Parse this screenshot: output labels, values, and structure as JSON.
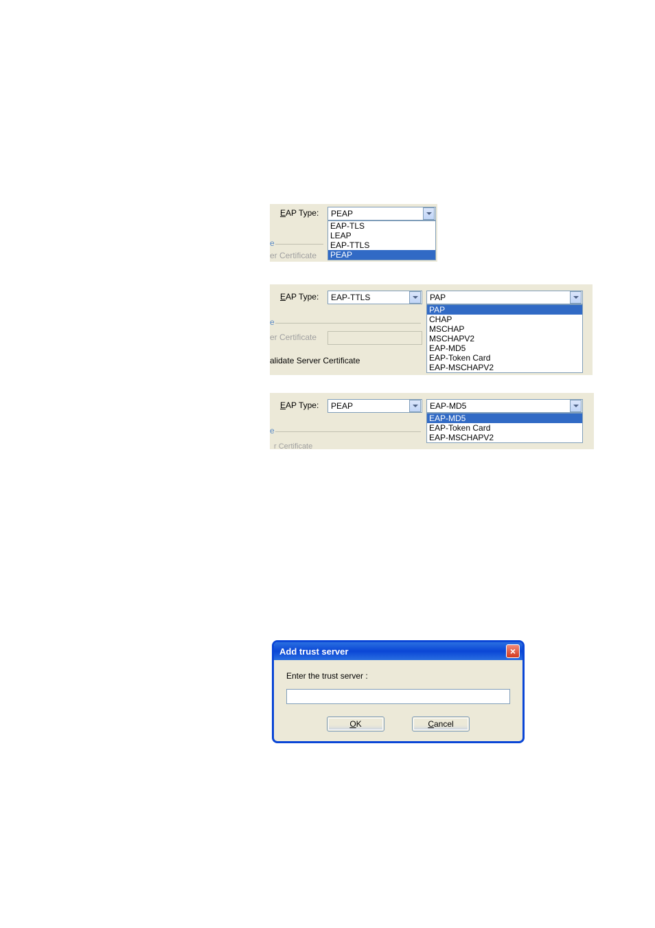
{
  "panel1": {
    "label_eap_type": "AP Type:",
    "label_eap_type_prefix": "E",
    "field_value": "PEAP",
    "list": [
      "EAP-TLS",
      "LEAP",
      "EAP-TTLS",
      "PEAP"
    ],
    "selected_index": 3,
    "frag_e": "e",
    "frag_cert": "er Certificate"
  },
  "panel2": {
    "label_eap_type": "AP Type:",
    "label_eap_type_prefix": "E",
    "field_value": "EAP-TTLS",
    "auth_value": "PAP",
    "list": [
      "PAP",
      "CHAP",
      "MSCHAP",
      "MSCHAPV2",
      "EAP-MD5",
      "EAP-Token Card",
      "EAP-MSCHAPV2"
    ],
    "selected_index": 0,
    "frag_e": "e",
    "frag_cert": "er Certificate",
    "frag_validate": "alidate Server Certificate"
  },
  "panel3": {
    "label_eap_type": "AP Type:",
    "label_eap_type_prefix": "E",
    "field_value": "PEAP",
    "auth_value": "EAP-MD5",
    "list": [
      "EAP-MD5",
      "EAP-Token Card",
      "EAP-MSCHAPV2"
    ],
    "selected_index": 0,
    "frag_e": "e",
    "frag_cert_faint": "r Certificate"
  },
  "dialog": {
    "title": "Add trust server",
    "prompt": "Enter the trust server :",
    "input_value": "",
    "ok_prefix": "O",
    "ok_rest": "K",
    "cancel_prefix": "C",
    "cancel_rest": "ancel"
  }
}
